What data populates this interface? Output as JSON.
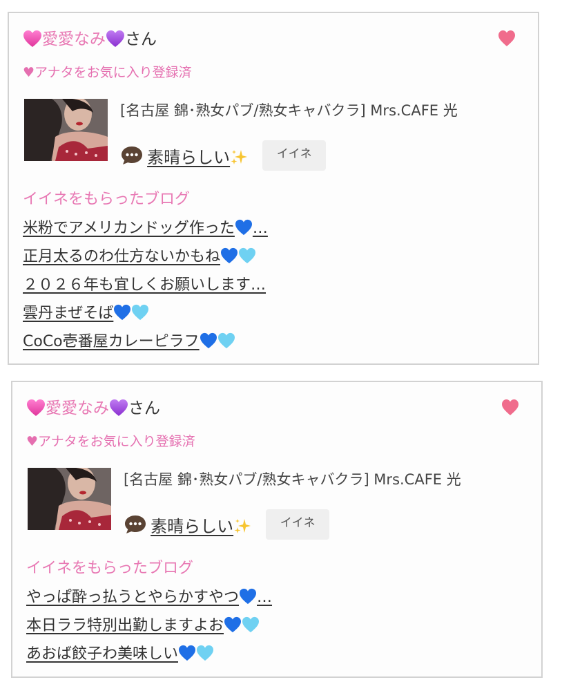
{
  "cards": [
    {
      "user_name": "愛愛なみ",
      "user_suffix": "さん",
      "favorite_status": "♥アナタをお気に入り登録済",
      "shop_name": "[名古屋 錦･熟女パブ/熟女キャバクラ]  Mrs.CAFE 光",
      "comment": "素晴らしい",
      "iine_label": "イイネ",
      "blog_heading": "イイネをもらったブログ",
      "blogs": [
        {
          "title": "米粉でアメリカンドッグ作った",
          "hearts": "blue",
          "ellipsis": "…"
        },
        {
          "title": "正月太るのわ仕方ないかもね",
          "hearts": "blue-light",
          "ellipsis": ""
        },
        {
          "title": "２０２６年も宜しくお願いします…",
          "hearts": "",
          "ellipsis": ""
        },
        {
          "title": "雲丹まぜそば",
          "hearts": "blue-light",
          "ellipsis": ""
        },
        {
          "title": "CoCo壱番屋カレーピラフ",
          "hearts": "blue-light",
          "ellipsis": ""
        }
      ]
    },
    {
      "user_name": "愛愛なみ",
      "user_suffix": "さん",
      "favorite_status": "♥アナタをお気に入り登録済",
      "shop_name": "[名古屋 錦･熟女パブ/熟女キャバクラ]  Mrs.CAFE 光",
      "comment": "素晴らしい",
      "iine_label": "イイネ",
      "blog_heading": "イイネをもらったブログ",
      "blogs": [
        {
          "title": "やっぱ酔っ払うとやらかすやつ",
          "hearts": "blue",
          "ellipsis": "…"
        },
        {
          "title": "本日ララ特別出勤しますよお",
          "hearts": "blue-light",
          "ellipsis": ""
        },
        {
          "title": "あおば餃子わ美味しい",
          "hearts": "blue-light",
          "ellipsis": ""
        }
      ]
    }
  ],
  "icons": {
    "pink_heart_emoji": "pink-heart-icon",
    "purple_heart_emoji": "purple-heart-icon",
    "like_heart": "heart-icon",
    "chat": "speech-bubble-icon",
    "sparkles": "sparkles-icon",
    "blue_heart": "blue-heart-icon",
    "light_blue_heart": "light-blue-heart-icon"
  },
  "colors": {
    "accent_pink": "#e879b4",
    "like_heart": "#f06c8c",
    "border": "#d2d2d2",
    "badge_bg": "#efefef"
  }
}
